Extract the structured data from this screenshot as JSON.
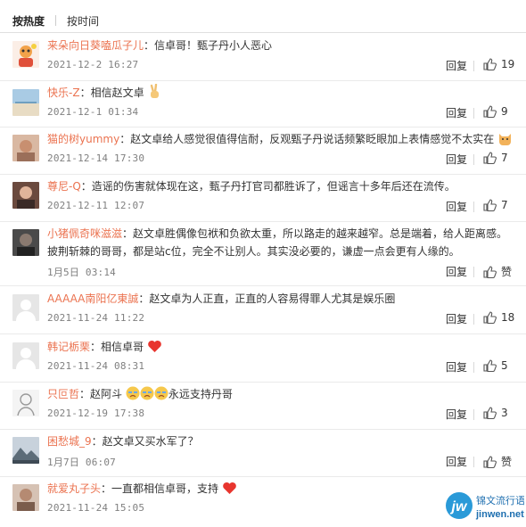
{
  "tabs": [
    "按热度",
    "按时间"
  ],
  "reply_label": "回复",
  "colors": {
    "username": "#eb7350",
    "meta": "#808080",
    "text": "#333333"
  },
  "comments": [
    {
      "user": "来朵向日葵嗑瓜子儿",
      "text": "：信卓哥！甄子丹小人恶心",
      "time": "2021-12-2 16:27",
      "likes": "19",
      "avatar": "cartoon-avatar"
    },
    {
      "user": "快乐-Z",
      "text": "：相信赵文卓",
      "time": "2021-12-1 01:34",
      "likes": "9",
      "avatar": "beach-avatar",
      "emoji": "victory-hand-emoji"
    },
    {
      "user": "猫的树yummy",
      "text": "：赵文卓给人感觉很值得信耐，反观甄子丹说话频繁眨眼加上表情感觉不太实在",
      "time": "2021-12-14 17:30",
      "likes": "7",
      "avatar": "photo-avatar",
      "emoji": "cat-face-emoji"
    },
    {
      "user": "尊尼-Q",
      "text": "：造谣的伤害就体现在这，甄子丹打官司都胜诉了，但谣言十多年后还在流传。",
      "time": "2021-12-11 12:07",
      "likes": "7",
      "avatar": "portrait-avatar"
    },
    {
      "user": "小猪佩奇咪滋滋",
      "text": "：赵文卓胜偶像包袱和负欲太重，所以路走的越来越窄。总是端着，给人距离感。披荆斩棘的哥哥，都是站c位，完全不让别人。其实没必要的，谦虚一点会更有人缘的。",
      "time": "1月5日 03:14",
      "likes": "赞",
      "avatar": "dark-photo-avatar"
    },
    {
      "user": "AAAAA南阳亿東誠",
      "text": "：赵文卓为人正直，正直的人容易得罪人尤其是娱乐圈",
      "time": "2021-11-24 11:22",
      "likes": "18",
      "avatar": "default-avatar"
    },
    {
      "user": "韩记栃栗",
      "text": "：相信卓哥",
      "time": "2021-11-24 08:31",
      "likes": "5",
      "avatar": "default-avatar",
      "emoji": "red-heart-emoji"
    },
    {
      "user": "只叵哲",
      "text": "：赵阿斗",
      "text2": "永远支持丹哥",
      "time": "2021-12-19 17:38",
      "likes": "3",
      "avatar": "sketch-avatar",
      "emoji": "crying-face-emoji"
    },
    {
      "user": "困愁城_9",
      "text": "：赵文卓又买水军了？",
      "time": "1月7日 06:07",
      "likes": "赞",
      "avatar": "mountain-avatar"
    },
    {
      "user": "就爱丸子头",
      "text": "：一直都相信卓哥，支持",
      "time": "2021-11-24 15:05",
      "likes": "",
      "avatar": "photo-avatar-2",
      "emoji": "red-heart-emoji"
    }
  ],
  "watermark": {
    "logo": "jw",
    "cn": "锦文流行语",
    "url": "jinwen.net"
  }
}
